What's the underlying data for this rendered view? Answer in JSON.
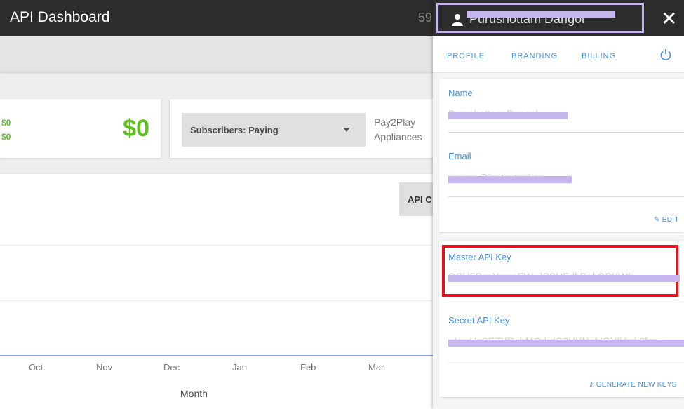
{
  "header": {
    "title": "API Dashboard",
    "number_partial": "59"
  },
  "revenue": {
    "line1": "$0",
    "line2": "$0",
    "total": "$0"
  },
  "subscribers": {
    "select_value": "Subscribers: Paying",
    "plan_line1": "Pay2Play",
    "plan_line2": "Appliances"
  },
  "chart": {
    "button_label": "API C",
    "x_ticks": [
      "Oct",
      "Nov",
      "Dec",
      "Jan",
      "Feb",
      "Mar"
    ],
    "x_title": "Month"
  },
  "panel": {
    "user_name": "Purushottam Dangol",
    "close_glyph": "✕",
    "tabs": [
      "PROFILE",
      "BRANDING",
      "BILLING"
    ],
    "profile": {
      "name_label": "Name",
      "name_value": "Purushottam Dangol",
      "email_label": "Email",
      "email_value": "purusp@instantapi.co",
      "edit_label": "EDIT"
    },
    "keys": {
      "master_label": "Master API Key",
      "master_value": "QSUFPspYqmgEWyJSBUFdLBdhQPYWfr",
      "secret_label": "Secret API Key",
      "secret_value": "gNruUxSEZYRebMQrhdQ0UYNoMOYIVmk8fzz",
      "generate_label": "GENERATE NEW KEYS"
    }
  },
  "colors": {
    "accent": "#4a90d9",
    "money": "#5bbf1c",
    "highlight": "#e3121b",
    "redaction": "#c7b6ee"
  }
}
